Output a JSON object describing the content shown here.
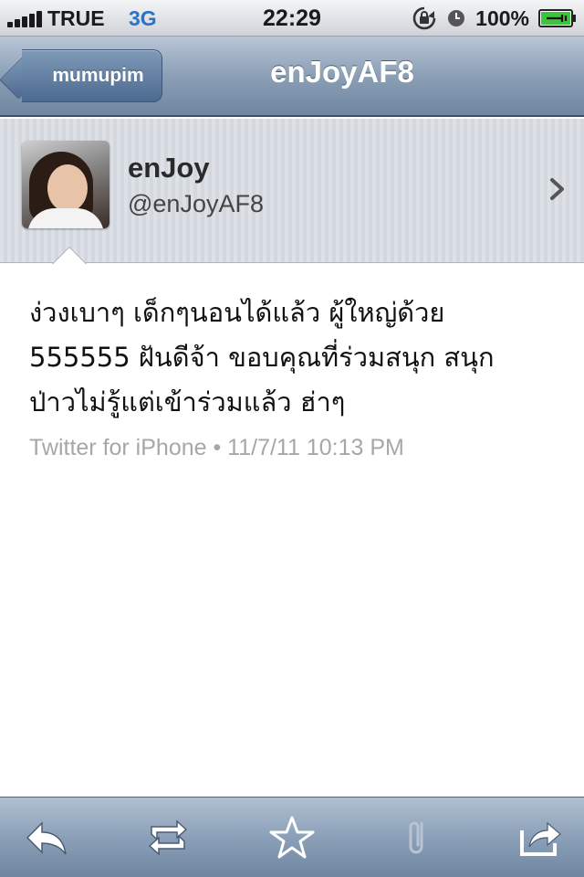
{
  "status_bar": {
    "carrier": "TRUE",
    "network": "3G",
    "time": "22:29",
    "battery": "100%",
    "icons": [
      "signal-icon",
      "rotation-lock-icon",
      "alarm-icon",
      "battery-charging-icon"
    ]
  },
  "nav": {
    "back_label": "mumupim",
    "title": "enJoyAF8"
  },
  "profile": {
    "name": "enJoy",
    "handle": "@enJoyAF8"
  },
  "tweet": {
    "line1": "ง่วงเบาๆ เด็กๆนอนได้แล้ว ผู้ใหญ่ด้วย",
    "line2": "555555 ฝันดีจ้า ขอบคุณที่ร่วมสนุก สนุก",
    "line3": "ป่าวไม่รู้แต่เข้าร่วมแล้ว ฮ่าๆ",
    "meta": "Twitter for iPhone • 11/7/11 10:13 PM"
  },
  "toolbar": {
    "icons": [
      "reply-icon",
      "retweet-icon",
      "favorite-star-icon",
      "attach-paperclip-icon",
      "share-icon"
    ]
  },
  "colors": {
    "nav_bar": "#8b9fb6",
    "network_blue": "#2a73c9",
    "meta_gray": "#a7a7a7"
  }
}
